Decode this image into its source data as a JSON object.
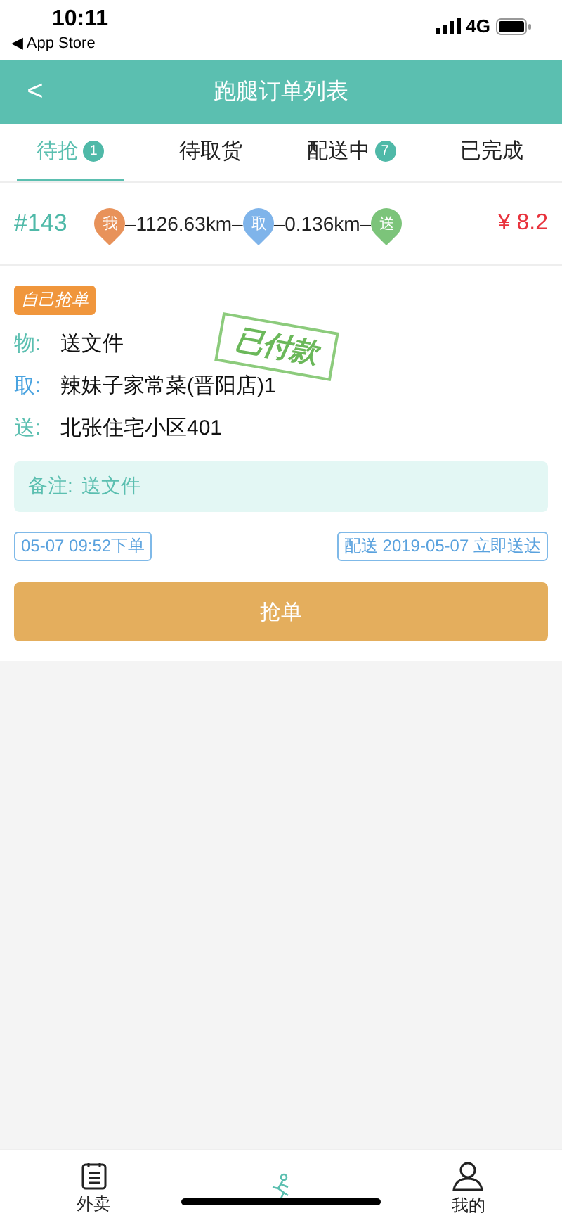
{
  "status_bar": {
    "time": "10:11",
    "back_app": "◀ App Store",
    "network": "4G"
  },
  "header": {
    "back": "<",
    "title": "跑腿订单列表"
  },
  "tabs": [
    {
      "label": "待抢",
      "badge": "1",
      "selected": true
    },
    {
      "label": "待取货",
      "selected": false
    },
    {
      "label": "配送中",
      "badge": "7",
      "selected": false
    },
    {
      "label": "已完成",
      "selected": false
    }
  ],
  "order": {
    "number": "#143",
    "route": [
      {
        "kind": "point",
        "label": "我",
        "color": "#e8925a"
      },
      {
        "kind": "distance",
        "text": "–1126.63km–"
      },
      {
        "kind": "point",
        "label": "取",
        "color": "#7fb4ea"
      },
      {
        "kind": "distance",
        "text": "–0.136km–"
      },
      {
        "kind": "point",
        "label": "送",
        "color": "#7cc47a"
      }
    ],
    "price": "¥ 8.2",
    "tag": "自己抢单",
    "stamp": "已付款",
    "details": [
      {
        "label": "物:",
        "value": "送文件",
        "color": "#5bbfb0"
      },
      {
        "label": "取:",
        "value": "辣妹子家常菜(晋阳店)1",
        "color": "#4aa3e0"
      },
      {
        "label": "送:",
        "value": "北张住宅小区401",
        "color": "#5bbfb0"
      }
    ],
    "note": {
      "label": "备注:",
      "value": "送文件"
    },
    "order_time": "05-07 09:52下单",
    "delivery_time": "配送 2019-05-07 立即送达",
    "action": "抢单"
  },
  "bottom_nav": [
    {
      "label": "外卖",
      "selected": false
    },
    {
      "selected": true
    },
    {
      "label": "我的",
      "selected": false
    }
  ]
}
